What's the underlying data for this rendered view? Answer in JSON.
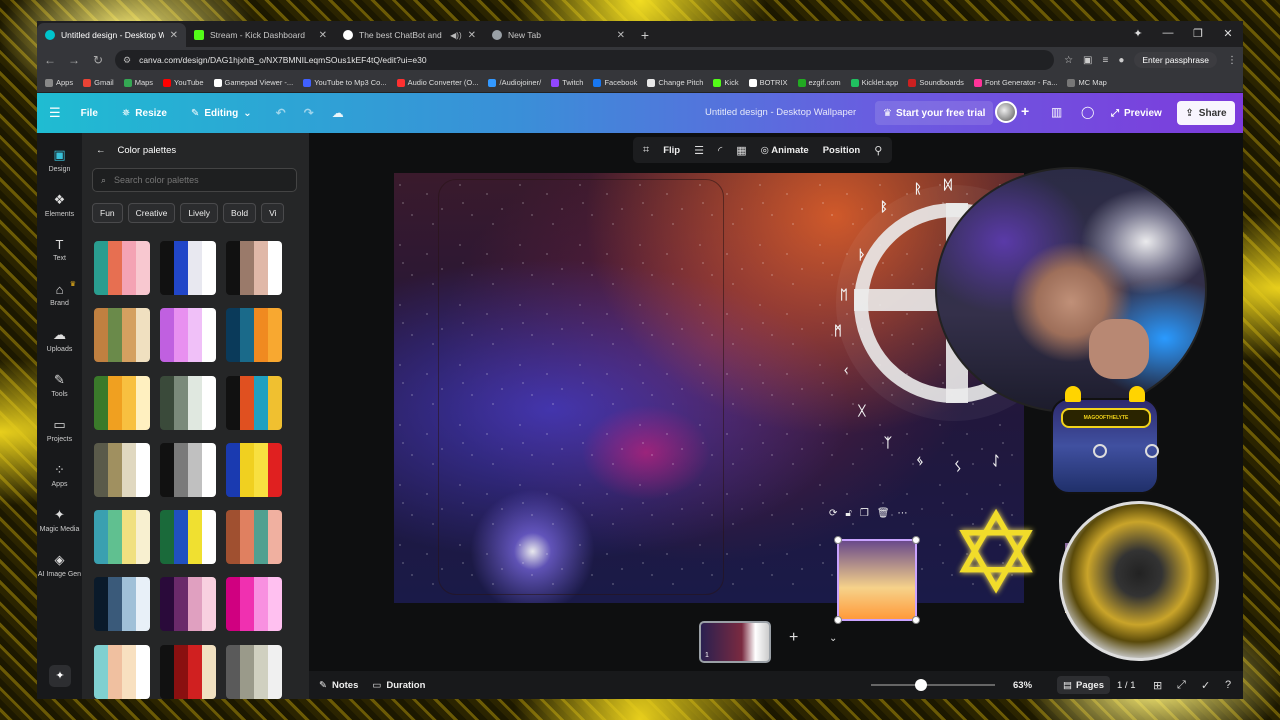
{
  "browser": {
    "tabs": [
      {
        "title": "Untitled design - Desktop Walli",
        "active": true,
        "color": "#00c4cc"
      },
      {
        "title": "Stream - Kick Dashboard",
        "active": false,
        "color": "#53fc18"
      },
      {
        "title": "The best ChatBot and Widg",
        "active": false,
        "color": "#ffffff"
      },
      {
        "title": "New Tab",
        "active": false,
        "color": "#9aa0a6"
      }
    ],
    "url": "canva.com/design/DAG1hjxhB_o/NX7BMNILeqmSOus1kEF4tQ/edit?ui=e30",
    "passphrase_label": "Enter passphrase",
    "bookmarks": [
      {
        "label": "Apps",
        "color": "#888888"
      },
      {
        "label": "Gmail",
        "color": "#ea4335"
      },
      {
        "label": "Maps",
        "color": "#34a853"
      },
      {
        "label": "YouTube",
        "color": "#ff0000"
      },
      {
        "label": "Gamepad Viewer -...",
        "color": "#ffffff"
      },
      {
        "label": "YouTube to Mp3 Co...",
        "color": "#4060ff"
      },
      {
        "label": "Audio Converter (O...",
        "color": "#ff3030"
      },
      {
        "label": "/Audiojoiner/",
        "color": "#3399ff"
      },
      {
        "label": "Twitch",
        "color": "#9146ff"
      },
      {
        "label": "Facebook",
        "color": "#1877f2"
      },
      {
        "label": "Change Pitch",
        "color": "#e8e8e8"
      },
      {
        "label": "Kick",
        "color": "#53fc18"
      },
      {
        "label": "BOTRIX",
        "color": "#ffffff"
      },
      {
        "label": "ezgif.com",
        "color": "#22aa22"
      },
      {
        "label": "Kicklet.app",
        "color": "#20c060"
      },
      {
        "label": "Soundboards",
        "color": "#cc2020"
      },
      {
        "label": "Font Generator - Fa...",
        "color": "#ff3399"
      },
      {
        "label": "MC Map",
        "color": "#777777"
      }
    ]
  },
  "canva_header": {
    "file": "File",
    "resize": "Resize",
    "editing": "Editing",
    "title": "Untitled design - Desktop Wallpaper",
    "trial": "Start your free trial",
    "preview": "Preview",
    "share": "Share"
  },
  "rail": [
    {
      "label": "Design",
      "icon": "design-icon",
      "glyph": "▣"
    },
    {
      "label": "Elements",
      "icon": "elements-icon",
      "glyph": "❖"
    },
    {
      "label": "Text",
      "icon": "text-icon",
      "glyph": "T"
    },
    {
      "label": "Brand",
      "icon": "brand-icon",
      "glyph": "⌂"
    },
    {
      "label": "Uploads",
      "icon": "uploads-icon",
      "glyph": "☁"
    },
    {
      "label": "Tools",
      "icon": "tools-icon",
      "glyph": "✎"
    },
    {
      "label": "Projects",
      "icon": "projects-icon",
      "glyph": "▭"
    },
    {
      "label": "Apps",
      "icon": "apps-icon",
      "glyph": "⁘"
    },
    {
      "label": "Magic Media",
      "icon": "magic-media-icon",
      "glyph": "✦"
    },
    {
      "label": "AI Image Gen",
      "icon": "ai-image-gen-icon",
      "glyph": "◈"
    }
  ],
  "panel": {
    "title": "Color palettes",
    "search_placeholder": "Search color palettes",
    "chips": [
      "Fun",
      "Creative",
      "Lively",
      "Bold",
      "Vi"
    ],
    "palettes": [
      [
        "#2a9d8f",
        "#e76f51",
        "#f4a3b4",
        "#f8c8d0"
      ],
      [
        "#111111",
        "#2146c8",
        "#e8e8f0",
        "#ffffff"
      ],
      [
        "#111111",
        "#9a7a6a",
        "#e0b8a8",
        "#ffffff"
      ],
      [
        "#c08040",
        "#6a8a4a",
        "#d4a060",
        "#f0e0c0"
      ],
      [
        "#c060e0",
        "#e890f0",
        "#f0c0f8",
        "#ffffff"
      ],
      [
        "#0a3a5a",
        "#1a6a8a",
        "#f08a20",
        "#f8a830"
      ],
      [
        "#3a7a2a",
        "#f0a020",
        "#f8c040",
        "#fff0c0"
      ],
      [
        "#3a4a3a",
        "#7a8a7a",
        "#e0e8e0",
        "#ffffff"
      ],
      [
        "#111111",
        "#e05020",
        "#20a0c0",
        "#f0c030"
      ],
      [
        "#5a5a4a",
        "#a09060",
        "#e0d8c0",
        "#ffffff"
      ],
      [
        "#111111",
        "#7a7a7a",
        "#c0c0c0",
        "#ffffff"
      ],
      [
        "#1a3ab0",
        "#f0d020",
        "#f8e040",
        "#e02020"
      ],
      [
        "#3aa0b0",
        "#60c090",
        "#f0e080",
        "#f8f0d0"
      ],
      [
        "#1a6a3a",
        "#2050c0",
        "#f0e030",
        "#ffffff"
      ],
      [
        "#a05030",
        "#e08060",
        "#50a090",
        "#f0b0a0"
      ],
      [
        "#0a1a2a",
        "#3a5a7a",
        "#a0c0d8",
        "#e8f0f8"
      ],
      [
        "#2a0a3a",
        "#6a2a6a",
        "#e0a0c0",
        "#f8d0e0"
      ],
      [
        "#d00080",
        "#f030b0",
        "#f890e0",
        "#ffc0f0"
      ],
      [
        "#80d0d0",
        "#f0c0a0",
        "#f8e0c0",
        "#ffffff"
      ],
      [
        "#111111",
        "#8a1010",
        "#d02020",
        "#f0e0c0"
      ],
      [
        "#5a5a5a",
        "#9a9a8a",
        "#d0d0c0",
        "#f0f0f0"
      ]
    ]
  },
  "toolbar": {
    "flip": "Flip",
    "animate": "Animate",
    "position": "Position"
  },
  "stream_overlay": {
    "controller_label": "MAGOOFTHELYTE"
  },
  "pages": {
    "thumb_number": "1",
    "pages_label": "Pages",
    "count": "1 / 1"
  },
  "footer": {
    "notes": "Notes",
    "duration": "Duration",
    "zoom": "63%",
    "zoom_fraction": 0.4
  },
  "colors": {
    "accent": "#39c1d9",
    "header_start": "#1fbcd2",
    "header_end": "#7d3bdc",
    "frame_glow": "#f2dd22"
  }
}
